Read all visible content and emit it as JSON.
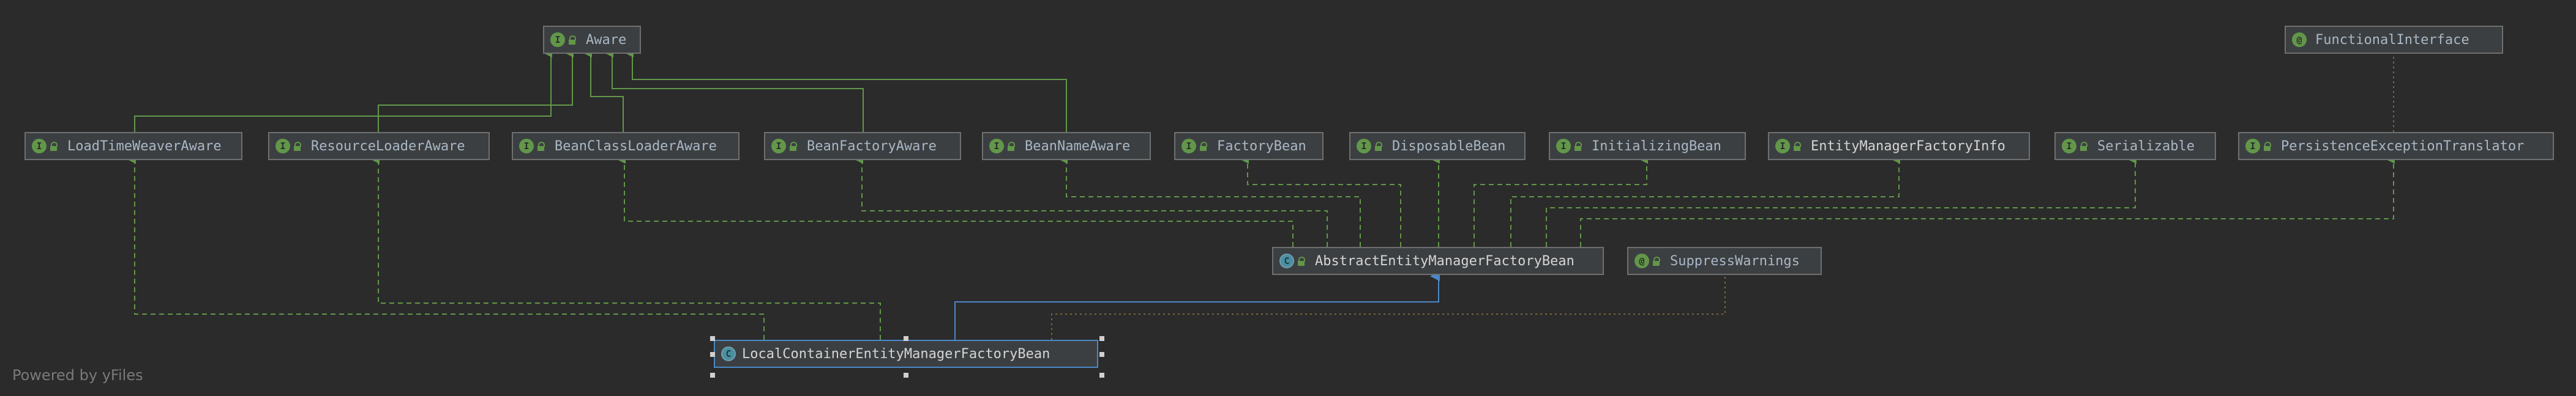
{
  "nodes": {
    "aware": {
      "label": "Aware",
      "kind": "interface"
    },
    "functional_interface": {
      "label": "FunctionalInterface",
      "kind": "annotation"
    },
    "load_time_weaver_aware": {
      "label": "LoadTimeWeaverAware",
      "kind": "interface"
    },
    "resource_loader_aware": {
      "label": "ResourceLoaderAware",
      "kind": "interface"
    },
    "bean_class_loader_aware": {
      "label": "BeanClassLoaderAware",
      "kind": "interface"
    },
    "bean_factory_aware": {
      "label": "BeanFactoryAware",
      "kind": "interface"
    },
    "bean_name_aware": {
      "label": "BeanNameAware",
      "kind": "interface"
    },
    "factory_bean": {
      "label": "FactoryBean",
      "kind": "interface"
    },
    "disposable_bean": {
      "label": "DisposableBean",
      "kind": "interface"
    },
    "initializing_bean": {
      "label": "InitializingBean",
      "kind": "interface"
    },
    "entity_manager_factory_info": {
      "label": "EntityManagerFactoryInfo",
      "kind": "interface"
    },
    "serializable": {
      "label": "Serializable",
      "kind": "interface"
    },
    "persistence_exception_translator": {
      "label": "PersistenceExceptionTranslator",
      "kind": "interface"
    },
    "abstract_entity_manager_factory_bean": {
      "label": "AbstractEntityManagerFactoryBean",
      "kind": "class"
    },
    "suppress_warnings": {
      "label": "SuppressWarnings",
      "kind": "annotation"
    },
    "local_container_entity_manager_factory_bean": {
      "label": "LocalContainerEntityManagerFactoryBean",
      "kind": "class"
    }
  },
  "icons": {
    "interface": "I",
    "class": "C",
    "annotation": "@"
  },
  "colors": {
    "background": "#2b2b2b",
    "interface_edge": "#62974a",
    "extends_edge": "#4a88c7",
    "annotation_edge": "#7a6b3c"
  },
  "footer": {
    "text": "Powered by yFiles"
  }
}
